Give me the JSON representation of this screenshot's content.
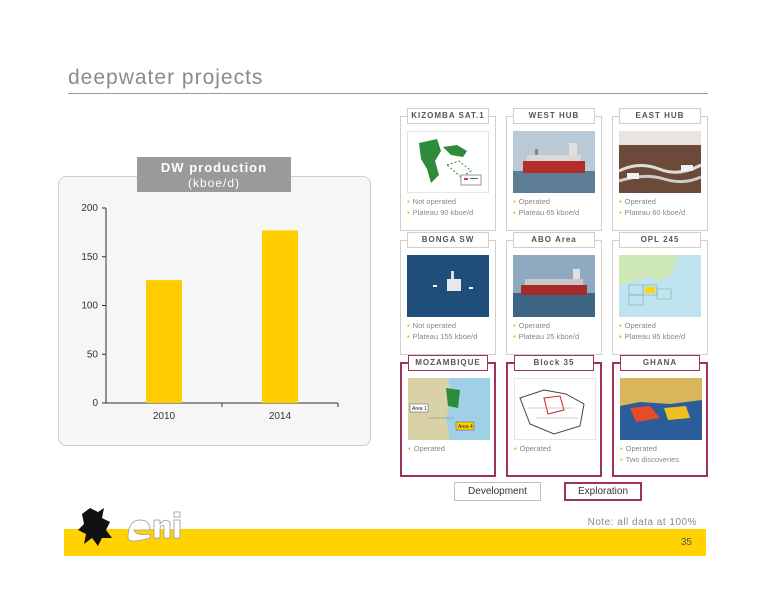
{
  "page": {
    "title": "deepwater projects",
    "note": "Note: all data at 100%",
    "page_number": "35"
  },
  "chart_header": {
    "line1": "DW production",
    "line2": "(kboe/d)"
  },
  "chart_data": {
    "type": "bar",
    "categories": [
      "2010",
      "2014"
    ],
    "values": [
      126,
      177
    ],
    "title": "DW production (kboe/d)",
    "xlabel": "",
    "ylabel": "",
    "ylim": [
      0,
      200
    ],
    "yticks": [
      0,
      50,
      100,
      150,
      200
    ],
    "grid": false,
    "bar_color": "#ffcc00"
  },
  "cards": [
    {
      "label": "KIZOMBA SAT.1",
      "bullets": [
        "Not operated",
        "Plateau 90 kboe/d"
      ],
      "type": "development",
      "image": "map-angola"
    },
    {
      "label": "WEST HUB",
      "bullets": [
        "Operated",
        "Plateau 65 kboe/d"
      ],
      "type": "development",
      "image": "fpso-ship"
    },
    {
      "label": "EAST HUB",
      "bullets": [
        "Operated",
        "Plateau 60 kboe/d"
      ],
      "type": "development",
      "image": "subsea-render"
    },
    {
      "label": "BONGA SW",
      "bullets": [
        "Not operated",
        "Plateau 155 kboe/d"
      ],
      "type": "development",
      "image": "offshore-platform"
    },
    {
      "label": "ABO Area",
      "bullets": [
        "Operated",
        "Plateau 25 kboe/d"
      ],
      "type": "development",
      "image": "fpso-ship"
    },
    {
      "label": "OPL 245",
      "bullets": [
        "Operated",
        "Plateau 85 kboe/d"
      ],
      "type": "development",
      "image": "block-map"
    },
    {
      "label": "MOZAMBIQUE",
      "bullets": [
        "Operated"
      ],
      "type": "exploration",
      "image": "map-mozambique",
      "map_labels": [
        "Area 1",
        "Area 4"
      ]
    },
    {
      "label": "Block 35",
      "bullets": [
        "Operated"
      ],
      "type": "exploration",
      "image": "map-block35"
    },
    {
      "label": "GHANA",
      "bullets": [
        "Operated",
        "Two discoveries"
      ],
      "type": "exploration",
      "image": "map-ghana"
    }
  ],
  "legend": {
    "development": "Development",
    "exploration": "Exploration"
  },
  "colors": {
    "accent_yellow": "#ffd200",
    "bar_yellow": "#ffcc00",
    "exploration_border": "#a0325a"
  }
}
